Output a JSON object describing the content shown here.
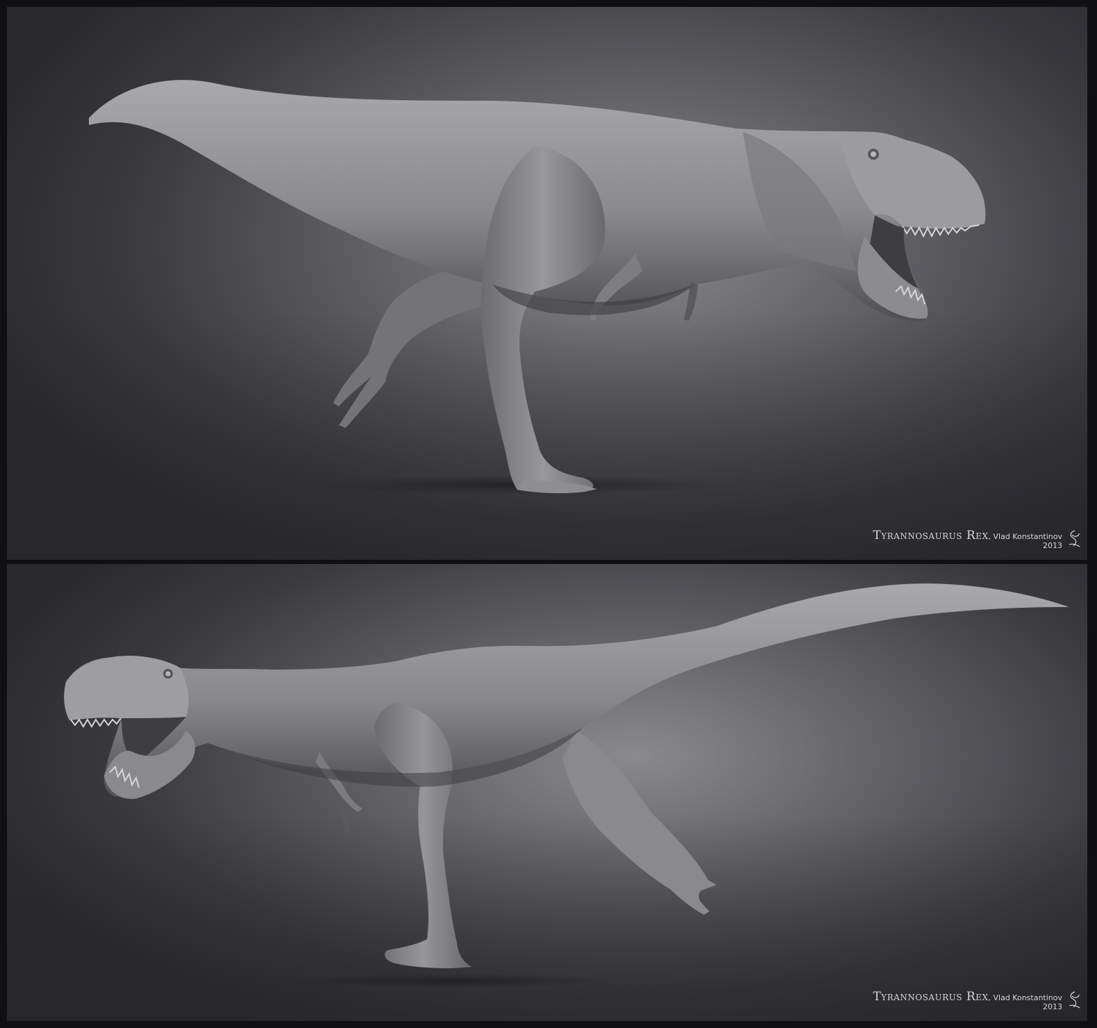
{
  "panels": [
    {
      "caption": {
        "title": "Tyrannosaurus Rex",
        "author": ", Vlad Konstantinov",
        "year": "2013"
      },
      "subject": "tyrannosaurus-sculpt-facing-right"
    },
    {
      "caption": {
        "title": "Tyrannosaurus Rex",
        "author": ", Vlad Konstantinov",
        "year": "2013"
      },
      "subject": "tyrannosaurus-sculpt-facing-left"
    }
  ],
  "colors": {
    "frame": "#101012",
    "background_light": "#8a8a8e",
    "background_dark": "#2a2a2f",
    "sculpt": "#8e8e92",
    "caption_text": "#d8d8dc"
  }
}
